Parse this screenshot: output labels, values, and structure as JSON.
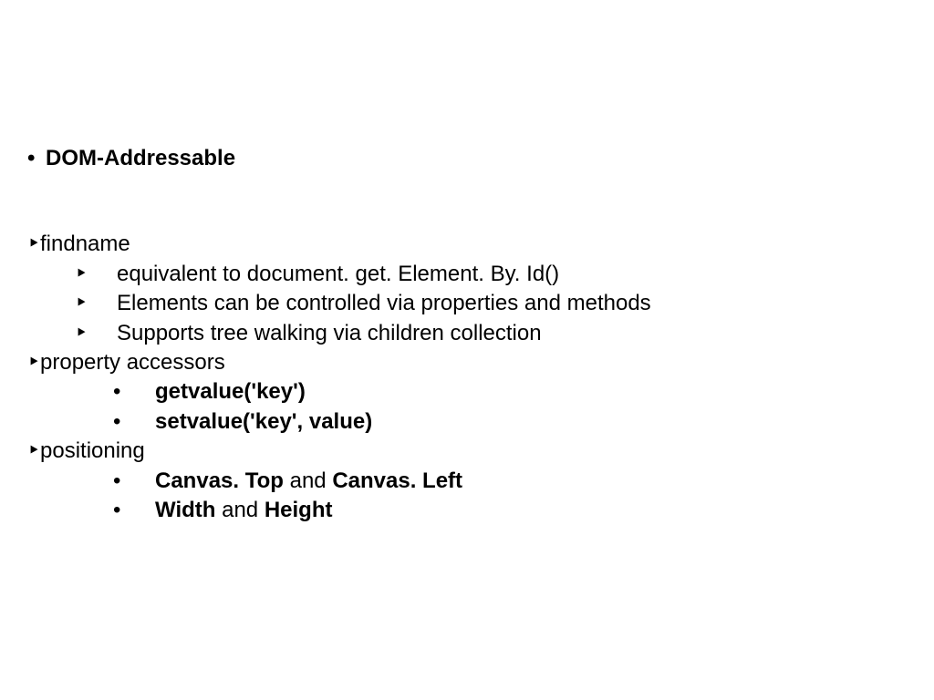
{
  "title": "DOM-Addressable",
  "sec1": {
    "head": "findname",
    "a": "equivalent to document. get. Element. By. Id()",
    "b": "Elements can be controlled via properties and methods",
    "c": "Supports tree walking via children collection"
  },
  "sec2": {
    "head": "property accessors",
    "a": "getvalue('key')",
    "b": "setvalue('key', value)"
  },
  "sec3": {
    "head": "positioning",
    "a1": "Canvas. Top",
    "a2": " and ",
    "a3": "Canvas. Left",
    "b1": "Width",
    "b2": " and ",
    "b3": "Height"
  }
}
